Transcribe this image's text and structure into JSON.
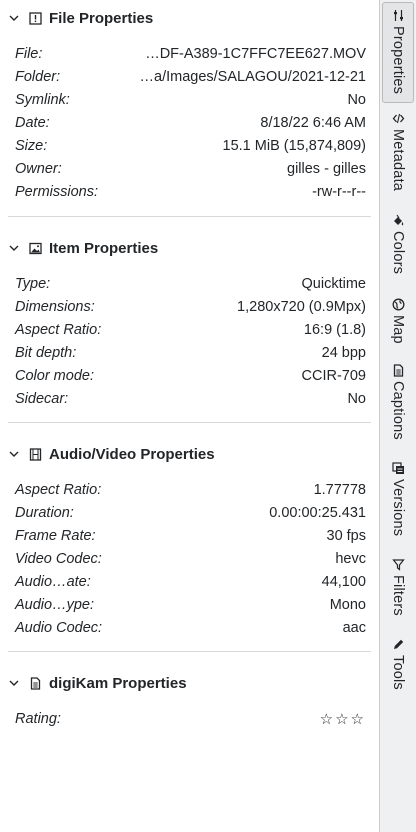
{
  "sections": [
    {
      "title": "File Properties",
      "icon": "info-icon",
      "rows": [
        {
          "key": "File:",
          "value": "…DF-A389-1C7FFC7EE627.MOV"
        },
        {
          "key": "Folder:",
          "value": "…a/Images/SALAGOU/2021-12-21"
        },
        {
          "key": "Symlink:",
          "value": "No"
        },
        {
          "key": "Date:",
          "value": "8/18/22 6:46 AM"
        },
        {
          "key": "Size:",
          "value": "15.1 MiB (15,874,809)"
        },
        {
          "key": "Owner:",
          "value": "gilles - gilles"
        },
        {
          "key": "Permissions:",
          "value": "-rw-r--r--"
        }
      ]
    },
    {
      "title": "Item Properties",
      "icon": "image-icon",
      "rows": [
        {
          "key": "Type:",
          "value": "Quicktime"
        },
        {
          "key": "Dimensions:",
          "value": "1,280x720 (0.9Mpx)"
        },
        {
          "key": "Aspect Ratio:",
          "value": "16:9 (1.8)"
        },
        {
          "key": "Bit depth:",
          "value": "24 bpp"
        },
        {
          "key": "Color mode:",
          "value": "CCIR-709"
        },
        {
          "key": "Sidecar:",
          "value": "No"
        }
      ]
    },
    {
      "title": "Audio/Video Properties",
      "icon": "film-icon",
      "rows": [
        {
          "key": "Aspect Ratio:",
          "value": "1.77778"
        },
        {
          "key": "Duration:",
          "value": "0.00:00:25.431"
        },
        {
          "key": "Frame Rate:",
          "value": "30 fps"
        },
        {
          "key": "Video Codec:",
          "value": "hevc"
        },
        {
          "key": "Audio…ate:",
          "value": "44,100"
        },
        {
          "key": "Audio…ype:",
          "value": "Mono"
        },
        {
          "key": "Audio Codec:",
          "value": "aac"
        }
      ]
    },
    {
      "title": "digiKam Properties",
      "icon": "document-icon",
      "rows": [
        {
          "key": "Rating:",
          "value": "☆☆☆"
        }
      ]
    }
  ],
  "tabs": [
    {
      "label": "Properties",
      "icon": "sliders-icon",
      "active": true
    },
    {
      "label": "Metadata",
      "icon": "code-icon"
    },
    {
      "label": "Colors",
      "icon": "paint-bucket-icon"
    },
    {
      "label": "Map",
      "icon": "globe-icon"
    },
    {
      "label": "Captions",
      "icon": "document-icon"
    },
    {
      "label": "Versions",
      "icon": "versions-icon"
    },
    {
      "label": "Filters",
      "icon": "filter-icon"
    },
    {
      "label": "Tools",
      "icon": "pencil-icon"
    }
  ]
}
